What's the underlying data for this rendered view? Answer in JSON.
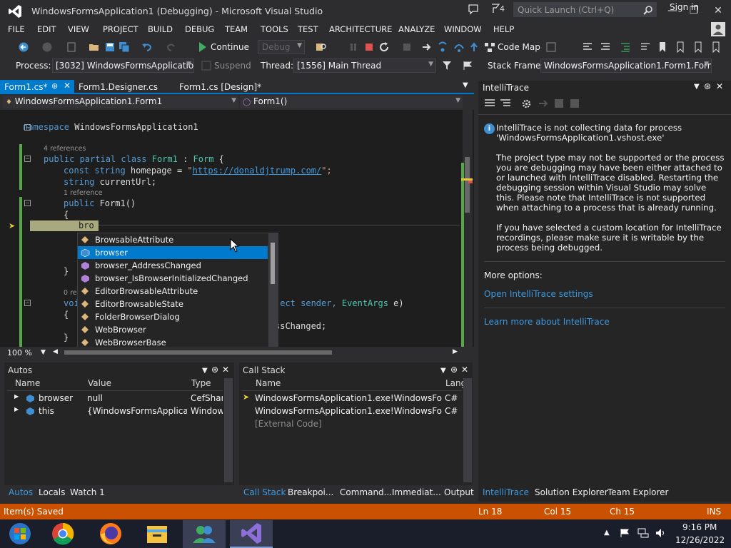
{
  "window": {
    "title": "WindowsFormsApplication1 (Debugging) - Microsoft Visual Studio",
    "notification_count": "4",
    "quick_launch_placeholder": "Quick Launch (Ctrl+Q)"
  },
  "menu": {
    "items": [
      "FILE",
      "EDIT",
      "VIEW",
      "PROJECT",
      "BUILD",
      "DEBUG",
      "TEAM",
      "TOOLS",
      "TEST",
      "ARCHITECTURE",
      "ANALYZE",
      "WINDOW",
      "HELP"
    ],
    "sign_in": "Sign in"
  },
  "toolbar": {
    "continue_label": "Continue",
    "config_value": "Debug",
    "code_map_label": "Code Map"
  },
  "debug_location": {
    "process_label": "Process:",
    "process_value": "[3032] WindowsFormsApplication",
    "suspend_label": "Suspend",
    "thread_label": "Thread:",
    "thread_value": "[1556] Main Thread",
    "stack_frame_label": "Stack Frame:",
    "stack_frame_value": "WindowsFormsApplication1.Form1.Form:"
  },
  "doc_tabs": [
    {
      "label": "Form1.cs*"
    },
    {
      "label": "Form1.Designer.cs"
    },
    {
      "label": "Form1.cs [Design]*"
    }
  ],
  "nav": {
    "type_dropdown": "WindowsFormsApplication1.Form1",
    "member_dropdown": "Form1()"
  },
  "code": {
    "namespace_kw": "namespace",
    "namespace_name": " WindowsFormsApplication1",
    "refs_4": "4 references",
    "class_line_kw": "public partial class",
    "class_name": " Form1",
    "class_colon": " : ",
    "class_base": "Form",
    "class_brace": " {",
    "const_kw": "const string",
    "const_rest": " homepage = ",
    "const_url": "https://donaldjtrump.com/",
    "const_end": "\";",
    "const_quote": "\"",
    "string_kw": "string",
    "string_rest": " currentUrl;",
    "refs_1": "1 reference",
    "ctor_kw": "public",
    "ctor_rest": " Form1()",
    "open_brace": "{",
    "typed": "bro",
    "close_brace": "}",
    "refs_0": "0 re",
    "void_kw": "voi",
    "event_tail_1": "ject sender, ",
    "event_args": "EventArgs",
    "event_tail_2": " e)",
    "open_brace_2": "{",
    "changed_tail": "ssChanged;",
    "close_brace_2": "}"
  },
  "intellisense": {
    "items": [
      {
        "label": "BrowsableAttribute",
        "kind": "class"
      },
      {
        "label": "browser",
        "kind": "field"
      },
      {
        "label": "browser_AddressChanged",
        "kind": "method"
      },
      {
        "label": "browser_IsBrowserInitializedChanged",
        "kind": "method"
      },
      {
        "label": "EditorBrowsableAttribute",
        "kind": "class"
      },
      {
        "label": "EditorBrowsableState",
        "kind": "class"
      },
      {
        "label": "FolderBrowserDialog",
        "kind": "class"
      },
      {
        "label": "WebBrowser",
        "kind": "class"
      },
      {
        "label": "WebBrowserBase",
        "kind": "class"
      }
    ],
    "selected_index": 1
  },
  "zoom": "100 %",
  "intellitrace": {
    "title": "IntelliTrace",
    "message_1": "IntelliTrace is not collecting data for process 'WindowsFormsApplication1.vshost.exe'",
    "message_2": "The project type may not be supported or the process you are debugging may have been either attached to or launched with IntelliTrace disabled.  Restarting the debugging session within Visual Studio may solve this. Please note that IntelliTrace is not supported when attaching to a process that is already running.",
    "message_3": "If you have selected a custom location for IntelliTrace recordings, please make sure it is writable by the process being debugged.",
    "more_options": "More options:",
    "link_settings": "Open IntelliTrace settings",
    "link_learn": "Learn more about IntelliTrace"
  },
  "autos": {
    "title": "Autos",
    "columns": [
      "Name",
      "Value",
      "Type"
    ],
    "rows": [
      {
        "name": "browser",
        "value": "null",
        "type": "CefShar"
      },
      {
        "name": "this",
        "value": "{WindowsFormsApplicatio",
        "type": "Windows"
      }
    ]
  },
  "callstack": {
    "title": "Call Stack",
    "columns": [
      "Name",
      "Lang"
    ],
    "rows": [
      {
        "name": "WindowsFormsApplication1.exe!WindowsFormsA",
        "lang": "C#"
      },
      {
        "name": "WindowsFormsApplication1.exe!WindowsFormsA",
        "lang": "C#"
      },
      {
        "name": "[External Code]",
        "lang": ""
      }
    ]
  },
  "bottom_tabs_left": [
    "Autos",
    "Locals",
    "Watch 1"
  ],
  "bottom_tabs_mid": [
    "Call Stack",
    "Breakpoi...",
    "Command...",
    "Immediat...",
    "Output"
  ],
  "bottom_tabs_right": [
    "IntelliTrace",
    "Solution Explorer",
    "Team Explorer"
  ],
  "status": {
    "message": "Item(s) Saved",
    "ln": "Ln 18",
    "col": "Col 15",
    "ch": "Ch 15",
    "mode": "INS"
  },
  "taskbar": {
    "time": "9:16 PM",
    "date": "12/26/2022"
  },
  "colors": {
    "accent": "#007acc",
    "status_bar": "#ca5100",
    "background": "#2d2d30",
    "editor_bg": "#1e1e1e"
  }
}
